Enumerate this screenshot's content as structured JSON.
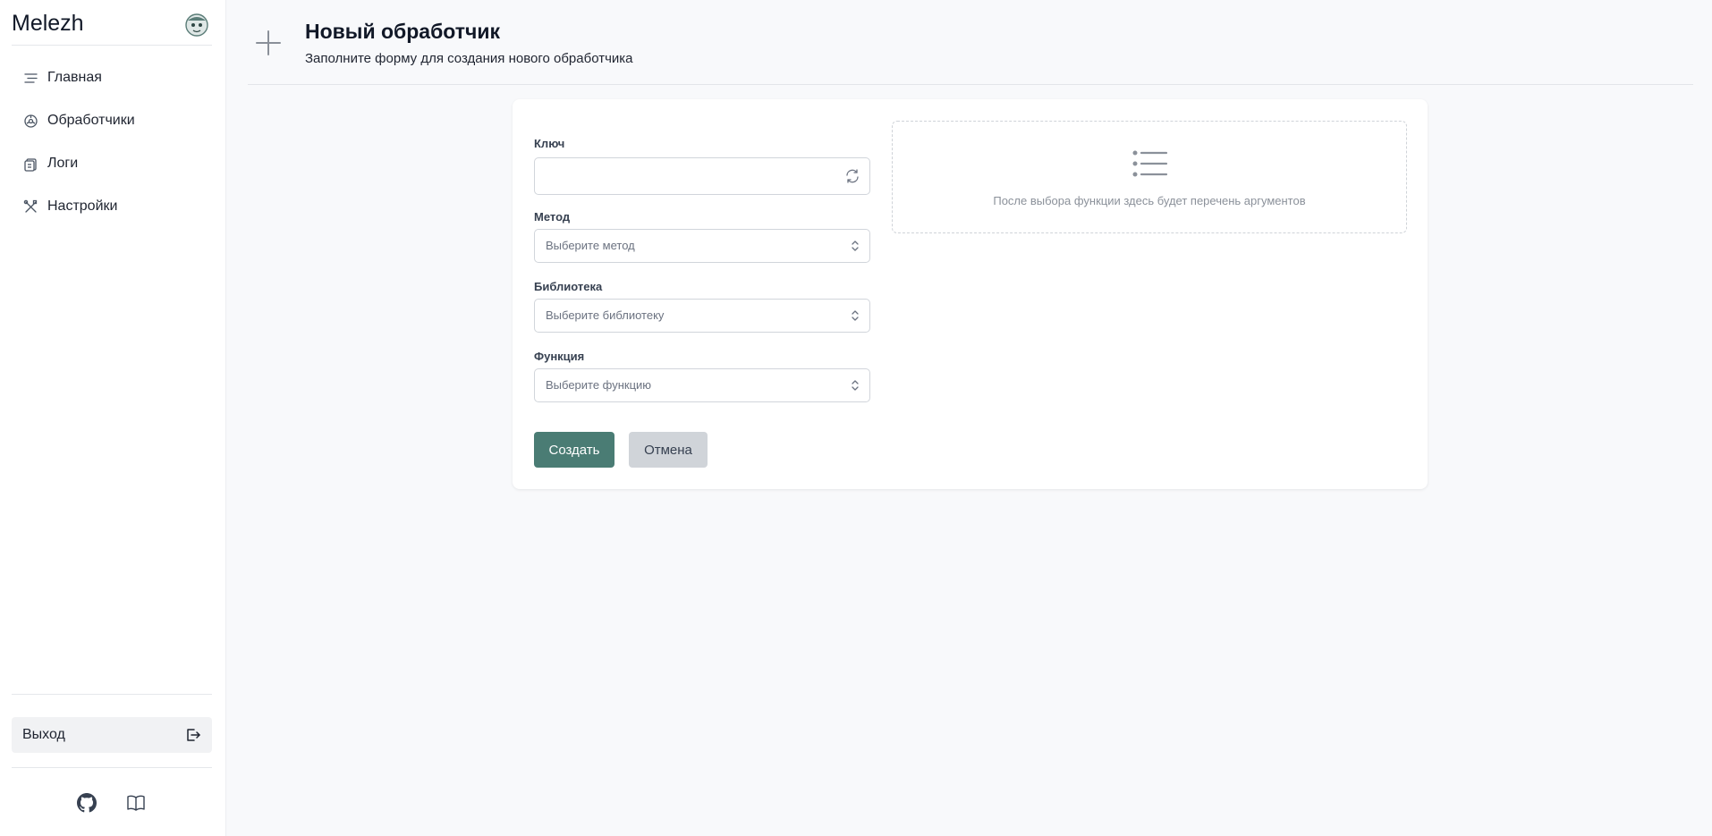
{
  "sidebar": {
    "brand": "Melezh",
    "avatar_icon": "mascot-avatar-icon",
    "items": [
      {
        "label": "Главная",
        "icon": "list-icon"
      },
      {
        "label": "Обработчики",
        "icon": "cog-icon"
      },
      {
        "label": "Логи",
        "icon": "clipboard-icon"
      },
      {
        "label": "Настройки",
        "icon": "tools-icon"
      }
    ],
    "logout_label": "Выход",
    "footer_icons": [
      "github-icon",
      "book-icon"
    ]
  },
  "header": {
    "title": "Новый обработчик",
    "subtitle": "Заполните форму для создания нового обработчика"
  },
  "form": {
    "key": {
      "label": "Ключ",
      "value": ""
    },
    "method": {
      "label": "Метод",
      "placeholder": "Выберите метод"
    },
    "library": {
      "label": "Библиотека",
      "placeholder": "Выберите библиотеку"
    },
    "function": {
      "label": "Функция",
      "placeholder": "Выберите функцию"
    },
    "submit_label": "Создать",
    "cancel_label": "Отмена",
    "args_hint": "После выбора функции здесь будет перечень аргументов"
  },
  "colors": {
    "accent": "#4a7c74",
    "cancel": "#d0d4d9",
    "background": "#f8f9fb"
  }
}
